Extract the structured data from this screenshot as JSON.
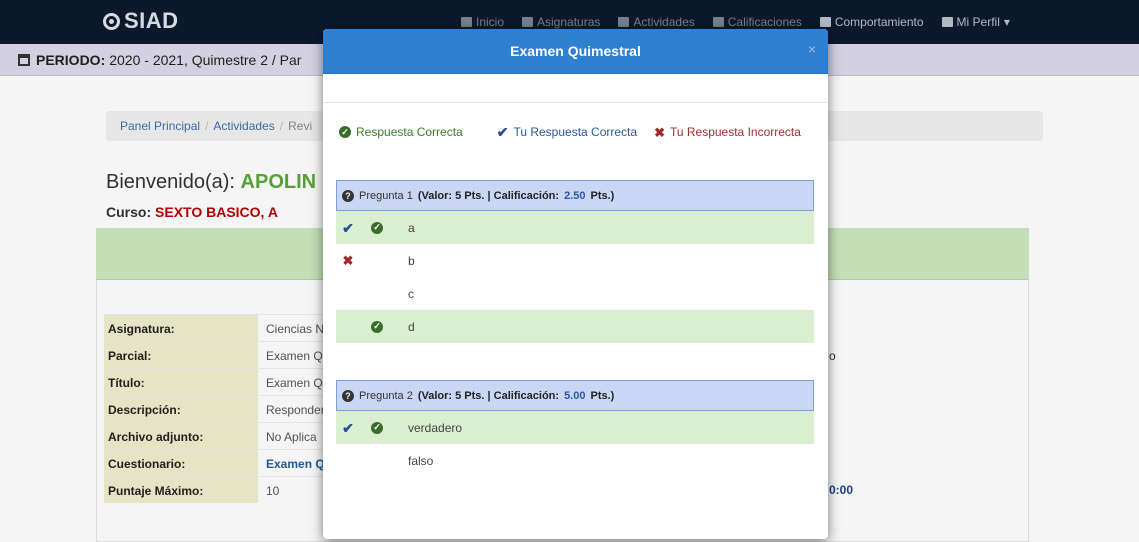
{
  "nav": {
    "brand": "SIAD",
    "items": [
      {
        "label": "Inicio",
        "icon": "grid-icon"
      },
      {
        "label": "Asignaturas",
        "icon": "book-icon"
      },
      {
        "label": "Actividades",
        "icon": "list-icon"
      },
      {
        "label": "Calificaciones",
        "icon": "grades-icon"
      },
      {
        "label": "Comportamiento",
        "icon": "card-icon"
      },
      {
        "label": "Mi Perfil",
        "icon": "user-icon"
      }
    ]
  },
  "period": {
    "label": "PERIODO:",
    "value": "2020 - 2021, Quimestre 2 / Par"
  },
  "breadcrumb": {
    "home": "Panel Principal",
    "activities": "Actividades",
    "current": "Revi"
  },
  "welcome": {
    "greeting": "Bienvenido(a):",
    "name": "APOLIN",
    "course_label": "Curso:",
    "course_name": "SEXTO BASICO, A"
  },
  "info": {
    "rows": [
      {
        "label": "Asignatura:",
        "value": "Ciencias N"
      },
      {
        "label": "Parcial:",
        "value": "Examen Qu"
      },
      {
        "label": "Título:",
        "value": "Examen Qu"
      },
      {
        "label": "Descripción:",
        "value": "Responder"
      },
      {
        "label": "Archivo adjunto:",
        "value": "No Aplica"
      },
      {
        "label": "Cuestionario:",
        "value": "Examen Q"
      },
      {
        "label": "Puntaje Máximo:",
        "value": "10"
      }
    ],
    "fragment_right_1": "o",
    "fragment_right_2": "0:00"
  },
  "modal": {
    "title": "Examen Quimestral",
    "close": "×",
    "legend": {
      "correct": "Respuesta Correcta",
      "mine_correct": "Tu Respuesta Correcta",
      "mine_incorrect": "Tu Respuesta Incorrecta"
    },
    "questions": [
      {
        "label": "Pregunta 1",
        "details": "(Valor: 5 Pts. | Calificación:",
        "score": "2.50",
        "unit": "Pts.)",
        "options": [
          {
            "text": "a",
            "mine": "check",
            "correct": true
          },
          {
            "text": "b",
            "mine": "x",
            "correct": false
          },
          {
            "text": "c",
            "mine": "",
            "correct": false
          },
          {
            "text": "d",
            "mine": "",
            "correct": true
          }
        ]
      },
      {
        "label": "Pregunta 2",
        "details": "(Valor: 5 Pts. | Calificación:",
        "score": "5.00",
        "unit": "Pts.)",
        "options": [
          {
            "text": "verdadero",
            "mine": "check",
            "correct": true
          },
          {
            "text": "falso",
            "mine": "",
            "correct": false
          }
        ]
      }
    ]
  },
  "colors": {
    "navbar": "#0d1b2e",
    "modal_header": "#2f7fd3",
    "correct_row": "#d9efcf",
    "question_header": "#c9d7f4",
    "welcome_name": "#5aa839",
    "course_name": "#bb0000"
  }
}
